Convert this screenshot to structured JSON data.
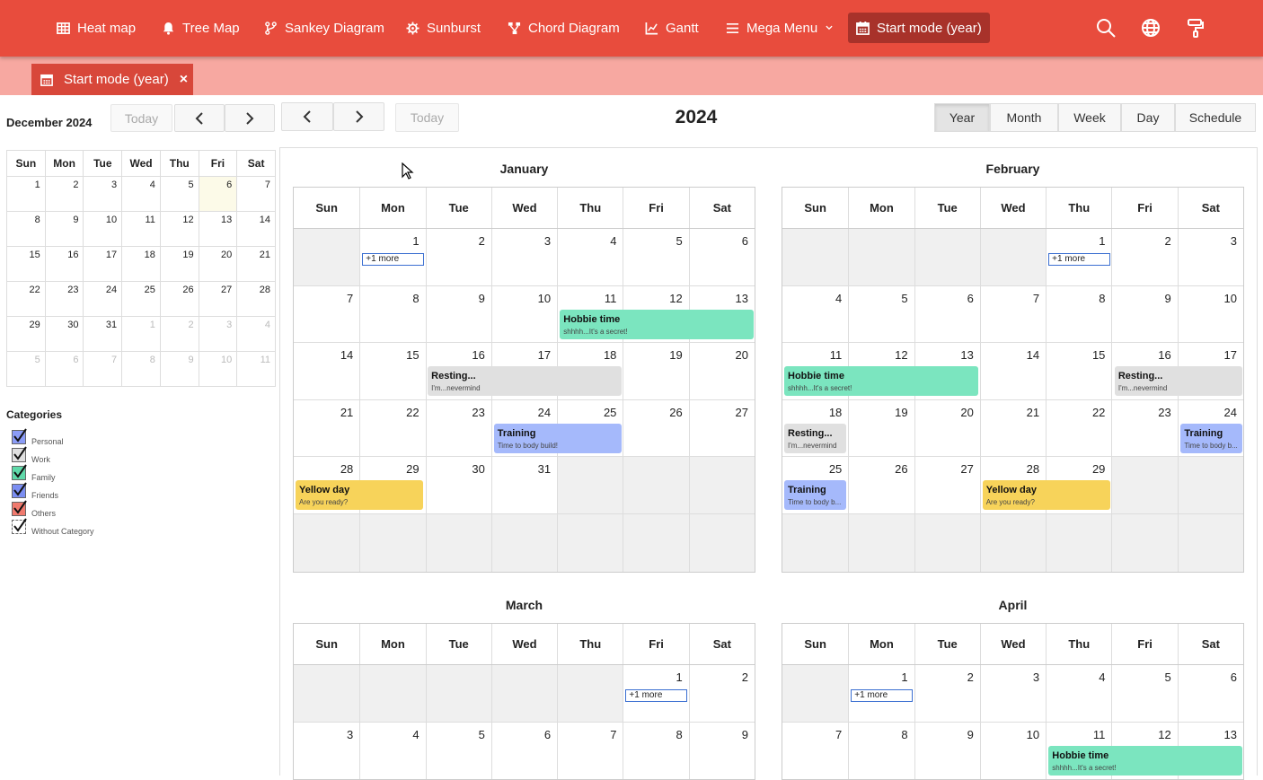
{
  "nav": {
    "items": [
      {
        "label": "Heat map",
        "icon": "grid-icon"
      },
      {
        "label": "Tree Map",
        "icon": "bell-icon"
      },
      {
        "label": "Sankey Diagram",
        "icon": "fork-icon"
      },
      {
        "label": "Sunburst",
        "icon": "gear-icon"
      },
      {
        "label": "Chord Diagram",
        "icon": "sitemap-icon"
      },
      {
        "label": "Gantt",
        "icon": "chart-icon"
      },
      {
        "label": "Mega Menu",
        "icon": "menu-icon"
      },
      {
        "label": "Start mode (year)",
        "icon": "calendar-icon"
      }
    ]
  },
  "tab": {
    "label": "Start mode (year)"
  },
  "mini": {
    "title": "December 2024",
    "today_label": "Today",
    "weekdays": [
      "Sun",
      "Mon",
      "Tue",
      "Wed",
      "Thu",
      "Fri",
      "Sat"
    ],
    "weeks": [
      [
        "1",
        "2",
        "3",
        "4",
        "5",
        "6",
        "7"
      ],
      [
        "8",
        "9",
        "10",
        "11",
        "12",
        "13",
        "14"
      ],
      [
        "15",
        "16",
        "17",
        "18",
        "19",
        "20",
        "21"
      ],
      [
        "22",
        "23",
        "24",
        "25",
        "26",
        "27",
        "28"
      ],
      [
        "29",
        "30",
        "31",
        "1",
        "2",
        "3",
        "4"
      ],
      [
        "5",
        "6",
        "7",
        "8",
        "9",
        "10",
        "11"
      ]
    ]
  },
  "categories": {
    "title": "Categories",
    "items": [
      {
        "label": "Personal",
        "color": "#8b9cf6"
      },
      {
        "label": "Work",
        "color": "#e0e0e0"
      },
      {
        "label": "Family",
        "color": "#5fd9a9"
      },
      {
        "label": "Friends",
        "color": "#7b8ef2"
      },
      {
        "label": "Others",
        "color": "#f07a6e"
      },
      {
        "label": "Without Category",
        "color": "#ffffff"
      }
    ]
  },
  "main": {
    "today_label": "Today",
    "title": "2024",
    "views": [
      "Year",
      "Month",
      "Week",
      "Day",
      "Schedule"
    ]
  },
  "year": {
    "weekdays": [
      "Sun",
      "Mon",
      "Tue",
      "Wed",
      "Thu",
      "Fri",
      "Sat"
    ],
    "more_label": "+1 more",
    "months": [
      {
        "name": "January",
        "weeks": [
          [
            "",
            "1",
            "2",
            "3",
            "4",
            "5",
            "6"
          ],
          [
            "7",
            "8",
            "9",
            "10",
            "11",
            "12",
            "13"
          ],
          [
            "14",
            "15",
            "16",
            "17",
            "18",
            "19",
            "20"
          ],
          [
            "21",
            "22",
            "23",
            "24",
            "25",
            "26",
            "27"
          ],
          [
            "28",
            "29",
            "30",
            "31",
            "",
            "",
            ""
          ],
          [
            "",
            "",
            "",
            "",
            "",
            "",
            ""
          ]
        ]
      },
      {
        "name": "February",
        "weeks": [
          [
            "",
            "",
            "",
            "",
            "1",
            "2",
            "3"
          ],
          [
            "4",
            "5",
            "6",
            "7",
            "8",
            "9",
            "10"
          ],
          [
            "11",
            "12",
            "13",
            "14",
            "15",
            "16",
            "17"
          ],
          [
            "18",
            "19",
            "20",
            "21",
            "22",
            "23",
            "24"
          ],
          [
            "25",
            "26",
            "27",
            "28",
            "29",
            "",
            ""
          ],
          [
            "",
            "",
            "",
            "",
            "",
            "",
            ""
          ]
        ]
      },
      {
        "name": "March",
        "weeks": [
          [
            "",
            "",
            "",
            "",
            "",
            "1",
            "2"
          ],
          [
            "3",
            "4",
            "5",
            "6",
            "7",
            "8",
            "9"
          ]
        ]
      },
      {
        "name": "April",
        "weeks": [
          [
            "",
            "1",
            "2",
            "3",
            "4",
            "5",
            "6"
          ],
          [
            "7",
            "8",
            "9",
            "10",
            "11",
            "12",
            "13"
          ]
        ]
      }
    ],
    "events": [
      {
        "title": "Hobbie time",
        "desc": "shhhh...It's a secret!"
      },
      {
        "title": "Resting...",
        "desc": "I'm...nevermind"
      },
      {
        "title": "Training",
        "desc": "Time to body build!"
      },
      {
        "title": "Yellow day",
        "desc": "Are you ready?"
      },
      {
        "title": "Training",
        "desc": "Time to body b..."
      }
    ]
  }
}
